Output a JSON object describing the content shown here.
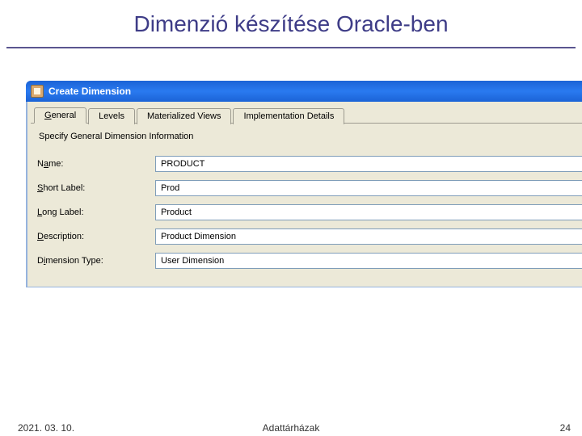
{
  "slide": {
    "title": "Dimenzió készítése Oracle-ben"
  },
  "window": {
    "title": "Create Dimension"
  },
  "tabs": {
    "general": "General",
    "levels": "Levels",
    "materialized": "Materialized Views",
    "implementation": "Implementation Details"
  },
  "section": {
    "legend": "Specify General Dimension Information"
  },
  "fields": {
    "name": {
      "label_pre": "N",
      "label_mn": "a",
      "label_post": "me:",
      "value": "PRODUCT"
    },
    "short": {
      "label_mn": "S",
      "label_post": "hort Label:",
      "value": "Prod"
    },
    "long": {
      "label_mn": "L",
      "label_post": "ong Label:",
      "value": "Product"
    },
    "desc": {
      "label_mn": "D",
      "label_post": "escription:",
      "value": "Product Dimension"
    },
    "type": {
      "label_pre": "D",
      "label_mn": "i",
      "label_post": "mension Type:",
      "value": "User Dimension"
    }
  },
  "footer": {
    "date": "2021. 03. 10.",
    "title": "Adattárházak",
    "page": "24"
  }
}
